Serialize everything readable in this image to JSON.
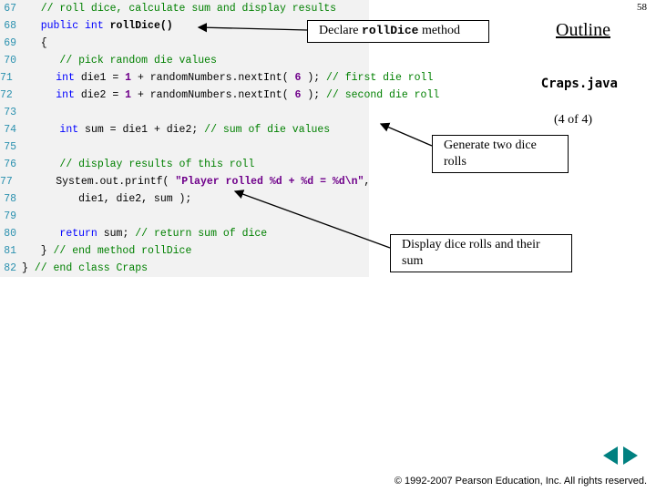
{
  "page_number": "58",
  "outline": {
    "heading": "Outline",
    "file": "Craps.java",
    "counter": "(4 of 4)"
  },
  "callouts": {
    "declare_pre": "Declare ",
    "declare_mono": "rollDice",
    "declare_post": " method",
    "generate": "Generate two dice rolls",
    "display": "Display dice rolls and their sum"
  },
  "code": [
    {
      "n": "67",
      "segs": [
        {
          "c": "c-comment",
          "t": "   // roll dice, calculate sum and display results"
        }
      ]
    },
    {
      "n": "68",
      "segs": [
        {
          "c": "c-normal",
          "t": "   "
        },
        {
          "c": "c-kw",
          "t": "public int"
        },
        {
          "c": "c-normal",
          "t": " "
        },
        {
          "c": "c-bold",
          "t": "rollDice()"
        }
      ]
    },
    {
      "n": "69",
      "segs": [
        {
          "c": "c-normal",
          "t": "   {"
        }
      ]
    },
    {
      "n": "70",
      "segs": [
        {
          "c": "c-normal",
          "t": "      "
        },
        {
          "c": "c-comment",
          "t": "// pick random die values"
        }
      ]
    },
    {
      "n": "71",
      "segs": [
        {
          "c": "c-normal",
          "t": "      "
        },
        {
          "c": "c-kw",
          "t": "int"
        },
        {
          "c": "c-normal",
          "t": " die1 = "
        },
        {
          "c": "c-purple",
          "t": "1"
        },
        {
          "c": "c-normal",
          "t": " + randomNumbers.nextInt( "
        },
        {
          "c": "c-purple",
          "t": "6"
        },
        {
          "c": "c-normal",
          "t": " ); "
        },
        {
          "c": "c-comment",
          "t": "// first die roll"
        }
      ]
    },
    {
      "n": "72",
      "segs": [
        {
          "c": "c-normal",
          "t": "      "
        },
        {
          "c": "c-kw",
          "t": "int"
        },
        {
          "c": "c-normal",
          "t": " die2 = "
        },
        {
          "c": "c-purple",
          "t": "1"
        },
        {
          "c": "c-normal",
          "t": " + randomNumbers.nextInt( "
        },
        {
          "c": "c-purple",
          "t": "6"
        },
        {
          "c": "c-normal",
          "t": " ); "
        },
        {
          "c": "c-comment",
          "t": "// second die roll"
        }
      ]
    },
    {
      "n": "73",
      "segs": [
        {
          "c": "c-normal",
          "t": ""
        }
      ]
    },
    {
      "n": "74",
      "segs": [
        {
          "c": "c-normal",
          "t": "      "
        },
        {
          "c": "c-kw",
          "t": "int"
        },
        {
          "c": "c-normal",
          "t": " sum = die1 + die2; "
        },
        {
          "c": "c-comment",
          "t": "// sum of die values"
        }
      ]
    },
    {
      "n": "75",
      "segs": [
        {
          "c": "c-normal",
          "t": ""
        }
      ]
    },
    {
      "n": "76",
      "segs": [
        {
          "c": "c-normal",
          "t": "      "
        },
        {
          "c": "c-comment",
          "t": "// display results of this roll"
        }
      ]
    },
    {
      "n": "77",
      "segs": [
        {
          "c": "c-normal",
          "t": "      System.out.printf( "
        },
        {
          "c": "c-purple",
          "t": "\"Player rolled %d + %d = %d\\n\""
        },
        {
          "c": "c-normal",
          "t": ","
        }
      ]
    },
    {
      "n": "78",
      "segs": [
        {
          "c": "c-normal",
          "t": "         die1, die2, sum );"
        }
      ]
    },
    {
      "n": "79",
      "segs": [
        {
          "c": "c-normal",
          "t": ""
        }
      ]
    },
    {
      "n": "80",
      "segs": [
        {
          "c": "c-normal",
          "t": "      "
        },
        {
          "c": "c-kw",
          "t": "return"
        },
        {
          "c": "c-normal",
          "t": " sum; "
        },
        {
          "c": "c-comment",
          "t": "// return sum of dice"
        }
      ]
    },
    {
      "n": "81",
      "segs": [
        {
          "c": "c-normal",
          "t": "   } "
        },
        {
          "c": "c-comment",
          "t": "// end method rollDice"
        }
      ]
    },
    {
      "n": "82",
      "segs": [
        {
          "c": "c-normal",
          "t": "} "
        },
        {
          "c": "c-comment",
          "t": "// end class Craps"
        }
      ]
    }
  ],
  "nav": {
    "prev": "previous",
    "next": "next"
  },
  "copyright": "© 1992-2007 Pearson Education, Inc.  All rights reserved."
}
